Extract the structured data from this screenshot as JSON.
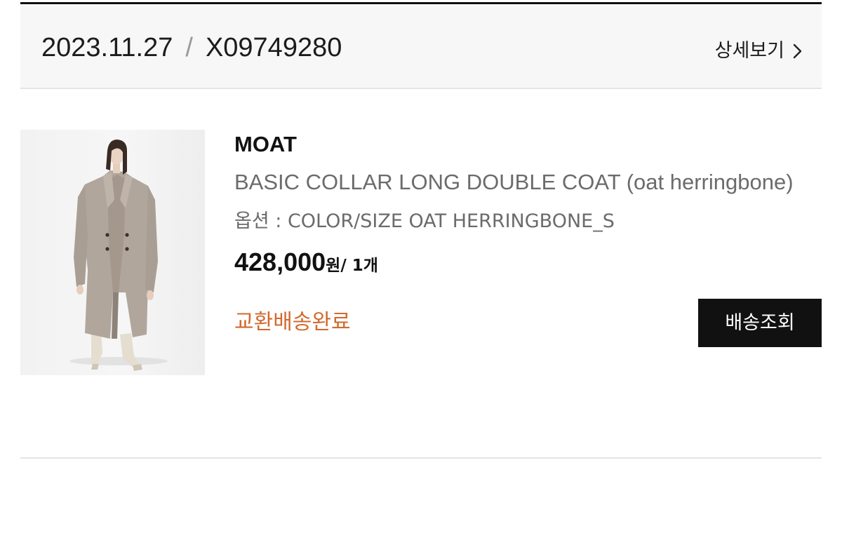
{
  "order": {
    "date": "2023.11.27",
    "separator": "/",
    "order_number": "X09749280",
    "detail_link_label": "상세보기"
  },
  "product": {
    "image_icon": "coat-product-photo",
    "brand": "MOAT",
    "name": "BASIC COLLAR LONG DOUBLE COAT (oat herringbone)",
    "option": "옵션 : COLOR/SIZE OAT HERRINGBONE_S",
    "price": "428,000",
    "price_unit": "원",
    "quantity": "/ 1개",
    "status": "교환배송완료",
    "track_button_label": "배송조회"
  },
  "colors": {
    "status": "#d2692e",
    "button_bg": "#111111",
    "header_bg": "#f7f7f7"
  }
}
